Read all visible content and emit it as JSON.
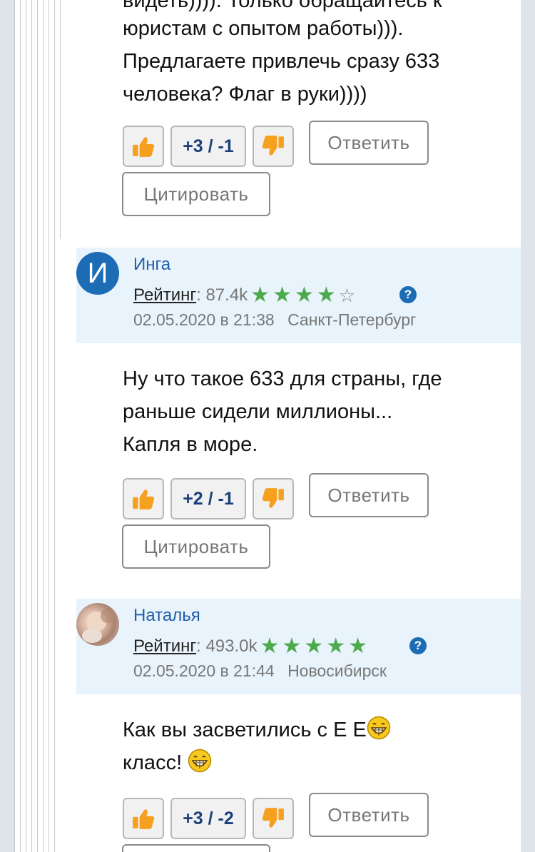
{
  "comment_top": {
    "cut_text": "видеть)))). Только обращайтесь к",
    "text_lines": [
      "юристам с опытом работы))).",
      "Предлагаете привлечь сразу 633",
      "человека? Флаг в руки))))"
    ],
    "score": "+3 / -1"
  },
  "comment_inga": {
    "avatar_letter": "И",
    "author": "Инга",
    "rating_label": "Рейтинг",
    "rating_value": ": 87.4k",
    "stars_filled": 4,
    "stars_total": 5,
    "date": "02.05.2020 в 21:38",
    "city": "Санкт-Петербург",
    "text_lines": [
      "Ну что такое 633 для страны, где",
      "раньше сидели миллионы...",
      "Капля в море."
    ],
    "score": "+2 / -1"
  },
  "comment_natalia": {
    "author": "Наталья",
    "rating_label": "Рейтинг",
    "rating_value": ": 493.0k",
    "stars_filled": 5,
    "stars_total": 5,
    "date": "02.05.2020 в 21:44",
    "city": "Новосибирск",
    "text_line1": "Как вы засветились с Е Е",
    "text_line2": "класс! ",
    "score": "+3 / -2"
  },
  "buttons": {
    "reply": "Ответить",
    "quote": "Цитировать",
    "help": "?"
  },
  "icons": {
    "like": "thumbs-up-icon",
    "dislike": "thumbs-down-icon",
    "smile": "grin-emoji-icon"
  },
  "colors": {
    "vote_orange": "#f5a01e",
    "star_green": "#4caa4c",
    "link_blue": "#1f5ea8",
    "header_bg": "#e8f3fb"
  }
}
